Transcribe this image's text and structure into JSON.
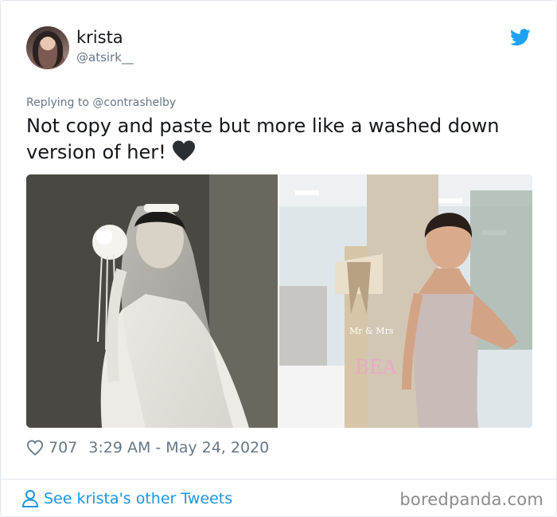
{
  "author": {
    "name": "krista",
    "handle": "@atsirk__",
    "avatar_icon": "profile-photo"
  },
  "reply": {
    "text": "Replying to @contrashelby"
  },
  "tweet": {
    "text": "Not copy and paste but more like a washed down version of her!",
    "emoji": "black-heart-icon"
  },
  "media": {
    "left_photo": "black-and-white bridal portrait",
    "right_photo": "woman in lace dress at event hall",
    "sign_text": "Mr & Mrs",
    "sign_letters": "BEA"
  },
  "meta": {
    "likes": "707",
    "timestamp": "3:29 AM - May 24, 2020"
  },
  "footer": {
    "see_more": "See krista's other Tweets",
    "watermark": "boredpanda.com"
  },
  "colors": {
    "twitter_blue": "#1da1f2",
    "link_blue": "#1b95e0",
    "muted": "#657786",
    "text": "#14171a"
  }
}
